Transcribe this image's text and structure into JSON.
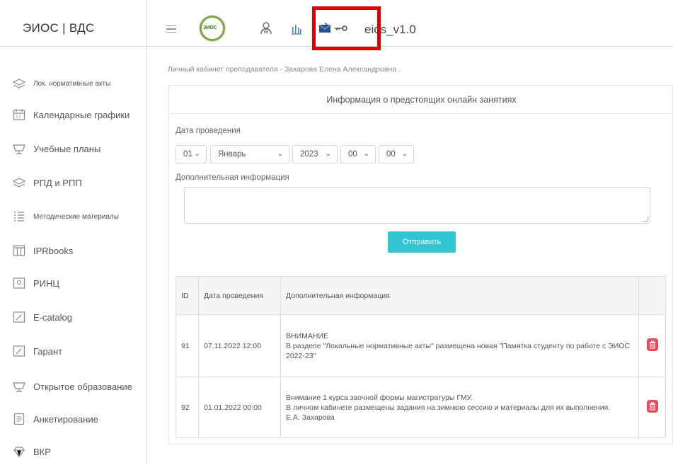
{
  "app": {
    "brand": "ЭИОС | ВДС",
    "title": "eios_v1.0"
  },
  "sidebar": {
    "items": [
      {
        "label": "Лок. нормативные акты",
        "icon": "layers-icon"
      },
      {
        "label": "Календарные графики",
        "icon": "calendar-icon"
      },
      {
        "label": "Учебные планы",
        "icon": "basket-icon"
      },
      {
        "label": "РПД и РПП",
        "icon": "layers-icon"
      },
      {
        "label": "Методические материалы",
        "icon": "list-icon"
      },
      {
        "label": "IPRbooks",
        "icon": "columns-icon"
      },
      {
        "label": "РИНЦ",
        "icon": "frame-icon"
      },
      {
        "label": "E-catalog",
        "icon": "note-icon"
      },
      {
        "label": "Гарант",
        "icon": "note-icon"
      },
      {
        "label": "Открытое образование",
        "icon": "basket-icon"
      },
      {
        "label": "Анкетирование",
        "icon": "doc-icon"
      },
      {
        "label": "ВКР",
        "icon": "diamond-icon"
      }
    ]
  },
  "breadcrumb": "Личный кабинет преподавателя - Захарова Елена Александровна .",
  "panel": {
    "title": "Информация о предстоящих онлайн занятиях",
    "date_label": "Дата проведения",
    "selects": {
      "day": "01",
      "month": "Январь",
      "year": "2023",
      "hour": "00",
      "minute": "00"
    },
    "info_label": "Дополнительная информация",
    "submit_label": "Отправить"
  },
  "table": {
    "headers": [
      "ID",
      "Дата проведения",
      "Дополнительная информация",
      ""
    ],
    "rows": [
      {
        "id": "91",
        "date": "07.11.2022 12:00",
        "lines": [
          "ВНИМАНИЕ",
          "В разделе \"Локальные нормативные акты\" размещена новая \"Памятка студенту по работе с ЭИОС 2022-23\""
        ]
      },
      {
        "id": "92",
        "date": "01.01.2022 00:00",
        "lines": [
          "Внимание 1 курса заочной формы магистратуры ГМУ.",
          "В личном кабинете размещены задания на зимнюю сессию и материалы для их выполнения.",
          "Е.А. Захарова"
        ]
      }
    ]
  },
  "colors": {
    "accent": "#32c5d2",
    "danger": "#e74c5b",
    "highlight": "#e00000"
  }
}
